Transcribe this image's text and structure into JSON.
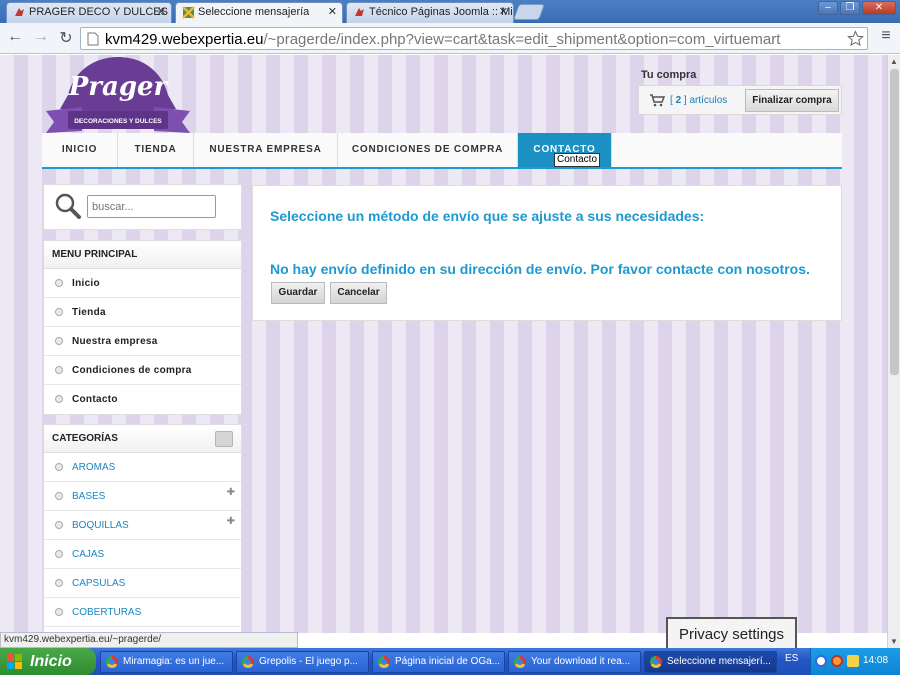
{
  "browser": {
    "tabs": [
      {
        "title": "PRAGER DECO Y DULCES - A",
        "active": false
      },
      {
        "title": "Seleccione mensajería",
        "active": true
      },
      {
        "title": "Técnico Páginas Joomla :: Mi",
        "active": false
      }
    ],
    "url_host": "kvm429.webexpertia.eu",
    "url_rest": "/~pragerde/index.php?view=cart&task=edit_shipment&option=com_virtuemart",
    "status_url": "kvm429.webexpertia.eu/~pragerde/"
  },
  "site": {
    "logo_name": "Prager",
    "logo_tagline": "DECORACIONES Y DULCES",
    "cart": {
      "title": "Tu compra",
      "count_open": "[",
      "count": "2",
      "count_close": "]",
      "count_label": "artículos",
      "checkout_label": "Finalizar compra"
    },
    "menu": [
      {
        "label": "INICIO",
        "active": false
      },
      {
        "label": "TIENDA",
        "active": false
      },
      {
        "label": "NUESTRA EMPRESA",
        "active": false
      },
      {
        "label": "CONDICIONES DE COMPRA",
        "active": false
      },
      {
        "label": "CONTACTO",
        "active": true
      }
    ],
    "tooltip": "Contacto",
    "search_placeholder": "buscar...",
    "main_menu": {
      "title": "MENU PRINCIPAL",
      "items": [
        "Inicio",
        "Tienda",
        "Nuestra empresa",
        "Condiciones de compra",
        "Contacto"
      ]
    },
    "categories": {
      "title": "CATEGORÍAS",
      "items": [
        {
          "label": "AROMAS",
          "expandable": false
        },
        {
          "label": "BASES",
          "expandable": true
        },
        {
          "label": "BOQUILLAS",
          "expandable": true
        },
        {
          "label": "CAJAS",
          "expandable": false
        },
        {
          "label": "CAPSULAS",
          "expandable": false
        },
        {
          "label": "COBERTURAS",
          "expandable": false
        }
      ]
    },
    "shipment": {
      "heading": "Seleccione un método de envío que se ajuste a sus necesidades:",
      "message": "No hay envío definido en su dirección de envío. Por favor contacte con nosotros.",
      "save_label": "Guardar",
      "cancel_label": "Cancelar"
    },
    "privacy_label": "Privacy settings"
  },
  "taskbar": {
    "start_label": "Inicio",
    "tasks": [
      {
        "label": "Miramagia: es un jue...",
        "active": false
      },
      {
        "label": "Grepolis - El juego p...",
        "active": false
      },
      {
        "label": "Página inicial de OGa...",
        "active": false
      },
      {
        "label": "Your download it rea...",
        "active": false
      },
      {
        "label": "Seleccione mensajerí...",
        "active": true
      }
    ],
    "language": "ES",
    "clock": "14:08"
  },
  "colors": {
    "accent": "#1d9ad0",
    "logo_purple": "#6a3d94",
    "link": "#1b86bf"
  }
}
